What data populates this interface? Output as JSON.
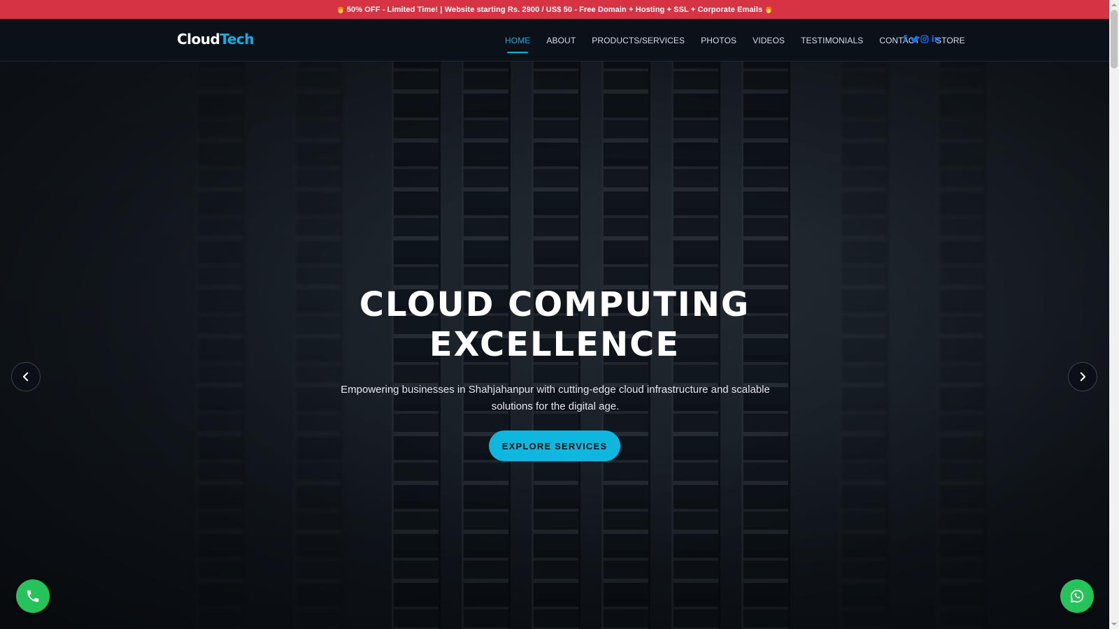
{
  "promo": {
    "text": "50% OFF - Limited Time! | Website starting Rs. 2900 / US$ 50 - Free Domain + Hosting + SSL + Corporate Emails"
  },
  "header": {
    "logo_part1": "Cloud",
    "logo_part2": "Tech",
    "nav": [
      {
        "label": "HOME"
      },
      {
        "label": "ABOUT"
      },
      {
        "label": "PRODUCTS/SERVICES"
      },
      {
        "label": "PHOTOS"
      },
      {
        "label": "VIDEOS"
      },
      {
        "label": "TESTIMONIALS"
      },
      {
        "label": "CONTACT"
      },
      {
        "label": "STORE"
      }
    ],
    "socials": [
      {
        "icon": "facebook-icon",
        "glyph": "f"
      },
      {
        "icon": "twitter-icon",
        "glyph": "t"
      },
      {
        "icon": "instagram-icon",
        "glyph": "◎"
      },
      {
        "icon": "linkedin-icon",
        "glyph": "in"
      }
    ]
  },
  "hero": {
    "title_line1": "CLOUD COMPUTING",
    "title_line2": "EXCELLENCE",
    "subtitle": "Empowering businesses in Shahjahanpur with cutting-edge cloud infrastructure and scalable solutions for the digital age.",
    "cta_label": "EXPLORE SERVICES"
  },
  "colors": {
    "promo_bg": "#d63444",
    "accent": "#15aee0",
    "cta": "#0fb6de",
    "nav_bg": "#0b1119",
    "fab": "#25c35a",
    "social": "#1e6cf0"
  },
  "icons": {
    "prev": "chevron-left-icon",
    "next": "chevron-right-icon",
    "phone": "phone-icon",
    "whatsapp": "whatsapp-icon",
    "promo": "fire-icon"
  }
}
